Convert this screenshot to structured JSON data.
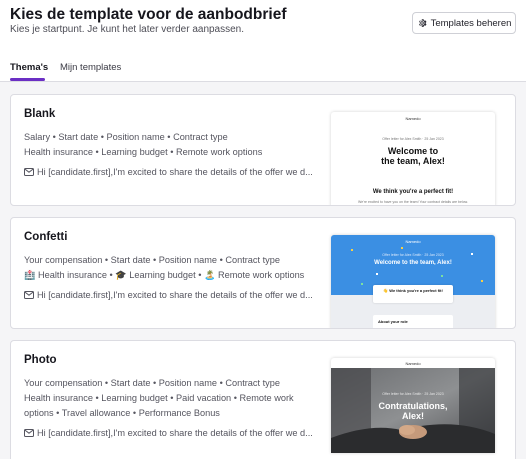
{
  "header": {
    "title": "Kies de template voor de aanbodbrief",
    "subtitle": "Kies je startpunt. Je kunt het later verder aanpassen.",
    "manage_button": {
      "label": "Templates beheren",
      "icon": "gear-icon"
    }
  },
  "tabs": [
    {
      "label": "Thema's",
      "active": true
    },
    {
      "label": "Mijn templates",
      "active": false
    }
  ],
  "colors": {
    "accent": "#6b2fc4",
    "confetti_blue": "#3b8fe3"
  },
  "templates": [
    {
      "title": "Blank",
      "lines": [
        "Salary • Start date • Position name • Contract type",
        "Health insurance • Learning budget • Remote work options"
      ],
      "email_preview": "Hi [candidate.first],I'm excited to share the details of the offer we d...",
      "preview": {
        "logo": "Namedo",
        "small": "Offer letter for Alex Smith · 25 Jan 2023",
        "heading_line1": "Welcome to",
        "heading_line2": "the team, Alex!",
        "subheading": "We think you're a perfect fit!",
        "body": "We're excited to have you on the team! Your contract details are below."
      }
    },
    {
      "title": "Confetti",
      "lines": [
        "Your compensation • Start date • Position name • Contract type",
        "🏥 Health insurance • 🎓 Learning budget • 🏝️ Remote work options"
      ],
      "email_preview": "Hi [candidate.first],I'm excited to share the details of the offer we d...",
      "preview": {
        "logo": "Namedo",
        "small": "Offer letter for Alex Smith · 25 Jan 2023",
        "heading": "Welcome to the team, Alex!",
        "subheading": "👋 We think you're a perfect fit!",
        "section": "About your role"
      }
    },
    {
      "title": "Photo",
      "lines": [
        "Your compensation • Start date • Position name • Contract type",
        "Health insurance • Learning budget • Paid vacation • Remote work",
        "options • Travel allowance • Performance Bonus"
      ],
      "email_preview": "Hi [candidate.first],I'm excited to share the details of the offer we d...",
      "preview": {
        "logo": "Namedo",
        "small": "Offer letter for Alex Smith · 25 Jan 2023",
        "heading_line1": "Contratulations,",
        "heading_line2": "Alex!"
      }
    }
  ]
}
